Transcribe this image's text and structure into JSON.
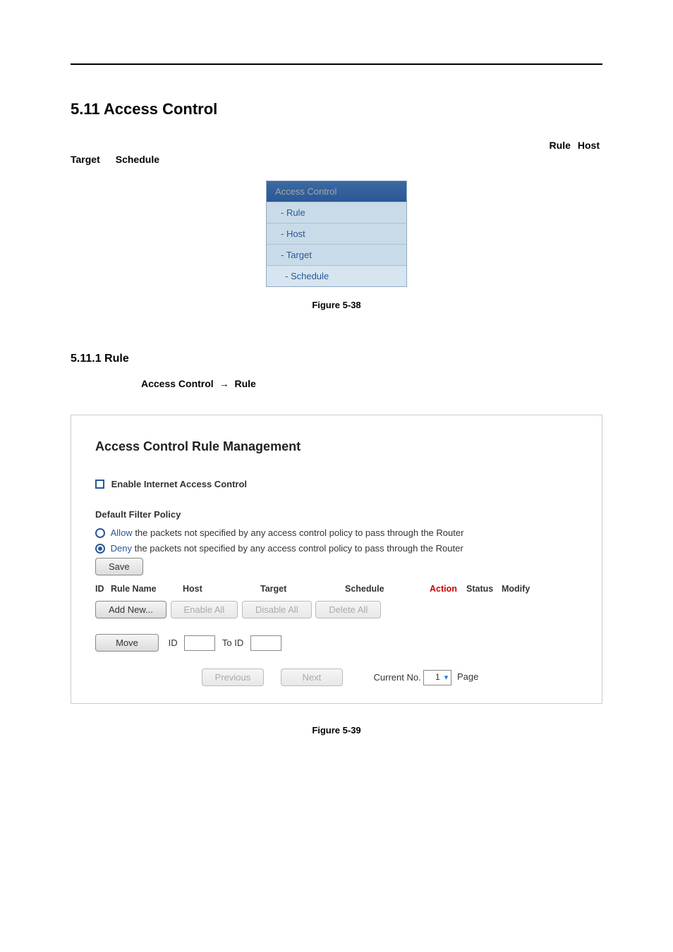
{
  "section": {
    "title": "5.11 Access Control"
  },
  "intro": {
    "line1_a": "Rule",
    "line1_b": "Host",
    "line2_a": "Target",
    "line2_b": "Schedule"
  },
  "nav": {
    "header": "Access Control",
    "items": [
      "- Rule",
      "- Host",
      "- Target"
    ],
    "sub": "- Schedule"
  },
  "fig38": "Figure 5-38",
  "sub511": {
    "title": "5.11.1 Rule",
    "crumb_a": "Access Control",
    "crumb_arrow": "→",
    "crumb_b": "Rule"
  },
  "panel": {
    "title": "Access Control Rule Management",
    "enable_label": "Enable Internet Access Control",
    "filter_head": "Default Filter Policy",
    "policy_allow_word": "Allow",
    "policy_allow_rest": " the packets not specified by any access control policy to pass through the Router",
    "policy_deny_word": "Deny",
    "policy_deny_rest": " the packets not specified by any access control policy to pass through the Router",
    "save_btn": "Save",
    "cols": {
      "id": "ID",
      "rule": "Rule Name",
      "host": "Host",
      "target": "Target",
      "schedule": "Schedule",
      "action": "Action",
      "status": "Status",
      "modify": "Modify"
    },
    "btns": {
      "add": "Add New...",
      "enable_all": "Enable All",
      "disable_all": "Disable All",
      "delete_all": "Delete All"
    },
    "move": {
      "btn": "Move",
      "id_lbl": "ID",
      "toid_lbl": "To ID"
    },
    "pager": {
      "prev": "Previous",
      "next": "Next",
      "curno": "Current No.",
      "page_val": "1",
      "page_lbl": "Page"
    }
  },
  "fig39": "Figure 5-39"
}
